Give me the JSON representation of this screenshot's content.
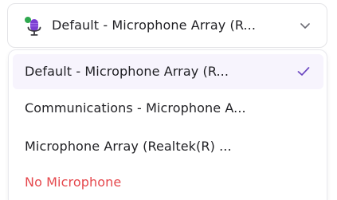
{
  "select": {
    "selected_label": "Default - Microphone Array (R...",
    "icon": "microphone-icon",
    "chevron_icon": "chevron-down-icon"
  },
  "menu": {
    "items": [
      {
        "label": "Default - Microphone Array (R...",
        "selected": true
      },
      {
        "label": "Communications - Microphone A...",
        "selected": false
      },
      {
        "label": "Microphone Array (Realtek(R) ...",
        "selected": false
      },
      {
        "label": "No Microphone",
        "selected": false,
        "danger": true
      }
    ],
    "check_icon": "check-icon"
  },
  "colors": {
    "accent": "#6b46c1",
    "text": "#1f1f23",
    "danger": "#e5484d",
    "selected_bg": "#f7f4fd",
    "border": "#e4e4e7"
  }
}
